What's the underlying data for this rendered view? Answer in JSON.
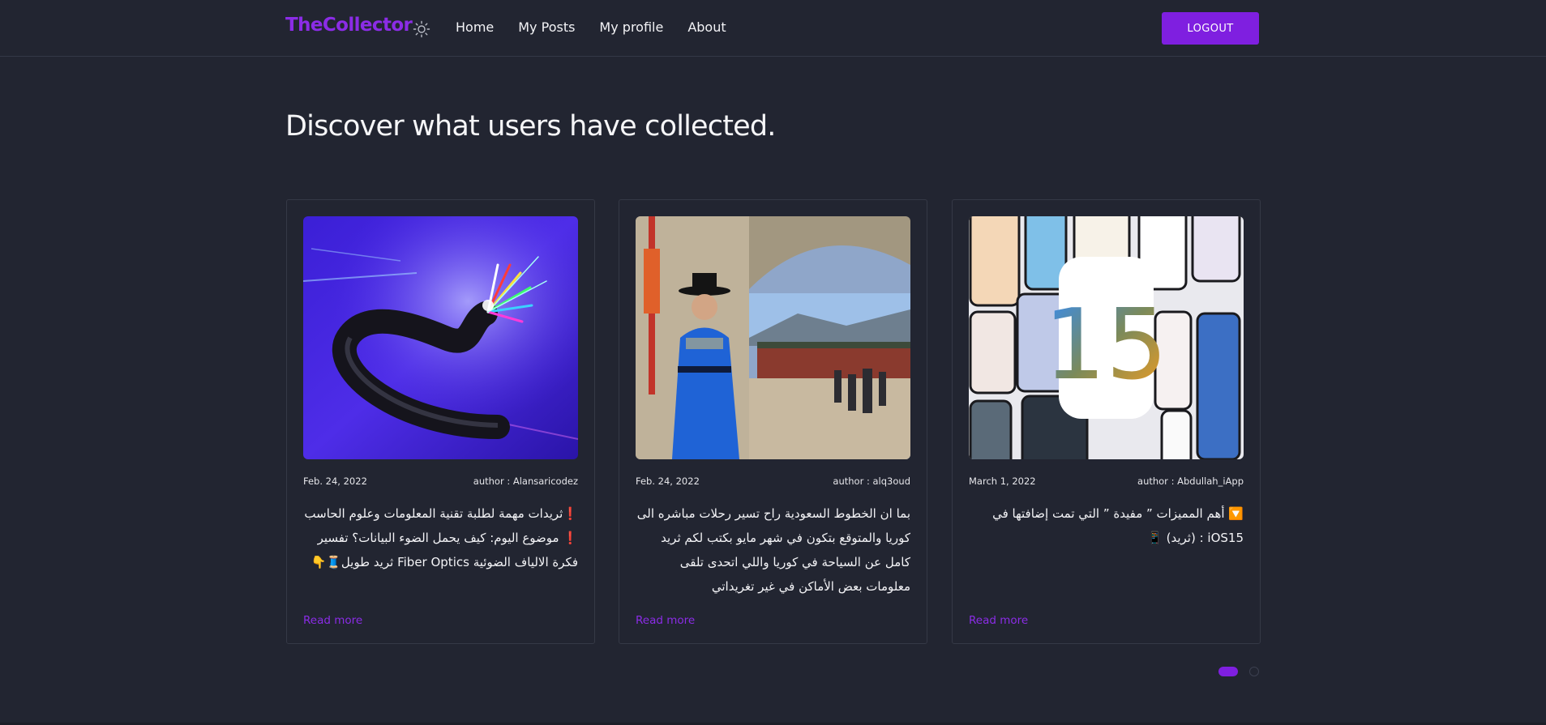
{
  "navbar": {
    "brand": "TheCollector",
    "theme_icon": "sun-icon",
    "links": [
      "Home",
      "My Posts",
      "My profile",
      "About"
    ],
    "logout_label": "LOGOUT"
  },
  "page_title": "Discover what users have collected.",
  "cards": [
    {
      "image": "fiber-optic-cable-image",
      "date": "Feb. 24, 2022",
      "author": "author : Alansaricodez",
      "text": "❗ثريدات مهمة لطلبة تقنية المعلومات وعلوم الحاسب ❗ موضوع اليوم: كيف يحمل الضوء البيانات؟ تفسير فكرة الالياف الضوئية Fiber Optics ثريد طويل🧵👇",
      "read_more": "Read more"
    },
    {
      "image": "korean-palace-guard-image",
      "date": "Feb. 24, 2022",
      "author": "author : alq3oud",
      "text": "بما ان الخطوط السعودية راح تسير رحلات مباشره الى كوريا والمتوقع بتكون في شهر مايو بكتب لكم ثريد كامل عن السياحة في كوريا واللي اتحدى تلقى معلومات بعض الأماكن في غير تغريداتي",
      "read_more": "Read more"
    },
    {
      "image": "ios15-phones-image",
      "date": "March 1, 2022",
      "author": "author : Abdullah_iApp",
      "text": "🔽 أهم المميزات ” مفيدة ” التي تمت إضافتها في iOS15 : (ثريد) 📱",
      "read_more": "Read more"
    }
  ],
  "pagination": {
    "pages": 2,
    "active": 1
  },
  "colors": {
    "background": "#222531",
    "accent": "#7f1fe0",
    "brand": "#8b2ce6",
    "border": "#353946"
  }
}
